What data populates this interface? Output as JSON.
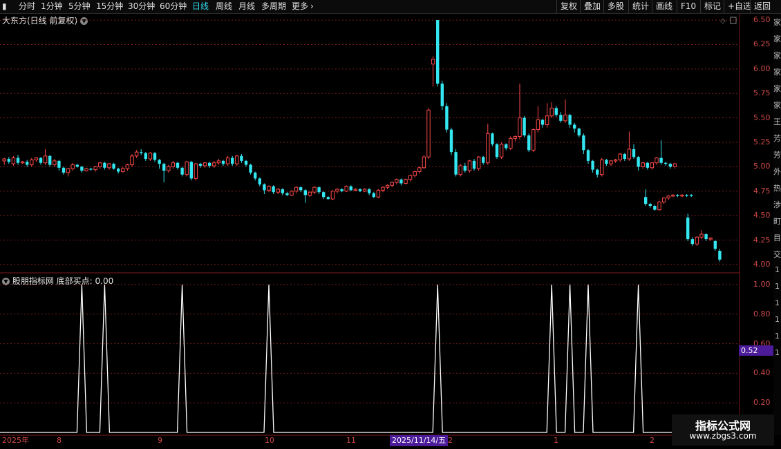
{
  "toolbar": {
    "periods": [
      "分时",
      "1分钟",
      "5分钟",
      "15分钟",
      "30分钟",
      "60分钟",
      "日线",
      "周线",
      "月线",
      "多周期",
      "更多"
    ],
    "active_period": "日线",
    "right_buttons": [
      "复权",
      "叠加",
      "多股",
      "统计",
      "画线",
      "F10",
      "标记",
      "+自选",
      "返回"
    ]
  },
  "stock": {
    "title": "大东方(日线 前复权)"
  },
  "indicator": {
    "title": "股朋指标网 底部买点: 0.00",
    "current_value": "0.52"
  },
  "right_strip_chars": [
    "家",
    "家",
    "家",
    "家",
    "家",
    "家",
    "王",
    "芳",
    "芳",
    "外",
    "热",
    "涉",
    "町",
    "目",
    "交",
    "1",
    "1",
    "1",
    "1",
    "1",
    "1"
  ],
  "date_axis": [
    "2025年",
    "8",
    "9",
    "10",
    "11",
    "2025/11/14/五",
    "2",
    "1",
    "2"
  ],
  "watermark": {
    "line1": "指标公式网",
    "line2": "www.zbgs3.com"
  },
  "colors": {
    "up": "#ff4a4a",
    "down": "#33e6f0",
    "grid": "#7a1d1d",
    "axis": "#d24a4a",
    "highlight": "#4b1b9a"
  },
  "chart_data": [
    {
      "type": "candlestick",
      "title": "大东方(日线 前复权)",
      "ylim": [
        3.95,
        6.55
      ],
      "yticks": [
        "6.50",
        "6.25",
        "6.00",
        "5.75",
        "5.50",
        "5.25",
        "5.00",
        "4.75",
        "4.50",
        "4.25",
        "4.00"
      ],
      "candles": [
        [
          5.06,
          5.08,
          5.02,
          5.09
        ],
        [
          5.08,
          5.05,
          5.03,
          5.1
        ],
        [
          5.03,
          5.09,
          5.01,
          5.11
        ],
        [
          5.09,
          5.04,
          5.02,
          5.12
        ],
        [
          5.04,
          5.05,
          5.03,
          5.06
        ],
        [
          5.05,
          5.02,
          5.0,
          5.07
        ],
        [
          5.02,
          5.07,
          5.0,
          5.09
        ],
        [
          5.07,
          5.09,
          5.05,
          5.1
        ],
        [
          5.09,
          5.04,
          5.02,
          5.1
        ],
        [
          5.04,
          5.11,
          5.02,
          5.18
        ],
        [
          5.11,
          5.02,
          5.0,
          5.12
        ],
        [
          5.02,
          5.06,
          5.0,
          5.08
        ],
        [
          5.06,
          4.99,
          4.96,
          5.07
        ],
        [
          4.99,
          4.94,
          4.92,
          5.0
        ],
        [
          4.94,
          4.98,
          4.9,
          4.99
        ],
        [
          4.98,
          5.02,
          4.96,
          5.04
        ],
        [
          5.02,
          5.0,
          4.99,
          5.03
        ],
        [
          5.0,
          4.96,
          4.94,
          5.01
        ],
        [
          4.96,
          4.98,
          4.95,
          4.99
        ],
        [
          4.98,
          4.97,
          4.96,
          4.99
        ],
        [
          4.97,
          5.0,
          4.95,
          5.01
        ],
        [
          5.0,
          5.04,
          4.98,
          5.05
        ],
        [
          5.04,
          4.99,
          4.97,
          5.05
        ],
        [
          4.99,
          5.03,
          4.97,
          5.04
        ],
        [
          5.03,
          4.98,
          4.97,
          5.04
        ],
        [
          4.98,
          4.95,
          4.93,
          4.99
        ],
        [
          4.95,
          4.98,
          4.94,
          5.0
        ],
        [
          4.98,
          5.02,
          4.96,
          5.03
        ],
        [
          5.02,
          5.11,
          5.0,
          5.13
        ],
        [
          5.11,
          5.15,
          5.09,
          5.17
        ],
        [
          5.15,
          5.14,
          5.12,
          5.18
        ],
        [
          5.14,
          5.08,
          5.06,
          5.15
        ],
        [
          5.08,
          5.14,
          5.06,
          5.15
        ],
        [
          5.14,
          5.07,
          5.05,
          5.15
        ],
        [
          5.07,
          5.03,
          4.98,
          5.08
        ],
        [
          5.03,
          4.96,
          4.84,
          5.04
        ],
        [
          4.96,
          5.0,
          4.94,
          5.02
        ],
        [
          5.0,
          5.04,
          4.98,
          5.06
        ],
        [
          5.04,
          4.99,
          4.97,
          5.05
        ],
        [
          4.99,
          4.92,
          4.9,
          5.0
        ],
        [
          4.92,
          5.05,
          4.9,
          5.06
        ],
        [
          5.05,
          4.88,
          4.86,
          5.06
        ],
        [
          4.88,
          5.03,
          4.86,
          5.04
        ],
        [
          5.03,
          5.01,
          4.99,
          5.04
        ],
        [
          5.01,
          5.04,
          4.99,
          5.05
        ],
        [
          5.04,
          5.01,
          4.99,
          5.05
        ],
        [
          5.01,
          5.04,
          4.99,
          5.06
        ],
        [
          5.04,
          5.06,
          5.02,
          5.08
        ],
        [
          5.06,
          5.03,
          5.01,
          5.07
        ],
        [
          5.03,
          5.09,
          5.01,
          5.11
        ],
        [
          5.09,
          5.03,
          5.01,
          5.11
        ],
        [
          5.03,
          5.11,
          5.01,
          5.12
        ],
        [
          5.11,
          5.06,
          5.04,
          5.13
        ],
        [
          5.06,
          5.02,
          5.0,
          5.07
        ],
        [
          5.02,
          4.94,
          4.92,
          5.03
        ],
        [
          4.94,
          4.88,
          4.86,
          4.95
        ],
        [
          4.88,
          4.82,
          4.8,
          4.89
        ],
        [
          4.82,
          4.76,
          4.72,
          4.83
        ],
        [
          4.76,
          4.8,
          4.74,
          4.81
        ],
        [
          4.8,
          4.74,
          4.72,
          4.81
        ],
        [
          4.74,
          4.77,
          4.72,
          4.78
        ],
        [
          4.77,
          4.73,
          4.71,
          4.78
        ],
        [
          4.73,
          4.71,
          4.7,
          4.74
        ],
        [
          4.71,
          4.75,
          4.7,
          4.76
        ],
        [
          4.75,
          4.79,
          4.73,
          4.8
        ],
        [
          4.79,
          4.76,
          4.74,
          4.8
        ],
        [
          4.76,
          4.71,
          4.63,
          4.77
        ],
        [
          4.71,
          4.74,
          4.69,
          4.75
        ],
        [
          4.74,
          4.79,
          4.72,
          4.8
        ],
        [
          4.79,
          4.74,
          4.72,
          4.8
        ],
        [
          4.74,
          4.69,
          4.67,
          4.75
        ],
        [
          4.69,
          4.67,
          4.66,
          4.7
        ],
        [
          4.67,
          4.75,
          4.66,
          4.76
        ],
        [
          4.75,
          4.77,
          4.73,
          4.78
        ],
        [
          4.77,
          4.75,
          4.74,
          4.78
        ],
        [
          4.75,
          4.8,
          4.74,
          4.81
        ],
        [
          4.8,
          4.76,
          4.75,
          4.81
        ],
        [
          4.76,
          4.77,
          4.75,
          4.78
        ],
        [
          4.77,
          4.75,
          4.74,
          4.78
        ],
        [
          4.75,
          4.77,
          4.74,
          4.78
        ],
        [
          4.77,
          4.73,
          4.71,
          4.78
        ],
        [
          4.73,
          4.69,
          4.68,
          4.74
        ],
        [
          4.69,
          4.76,
          4.68,
          4.77
        ],
        [
          4.76,
          4.79,
          4.74,
          4.8
        ],
        [
          4.79,
          4.81,
          4.77,
          4.82
        ],
        [
          4.81,
          4.84,
          4.79,
          4.85
        ],
        [
          4.84,
          4.87,
          4.82,
          4.88
        ],
        [
          4.87,
          4.83,
          4.81,
          4.88
        ],
        [
          4.83,
          4.87,
          4.82,
          4.88
        ],
        [
          4.87,
          4.91,
          4.85,
          4.92
        ],
        [
          4.91,
          4.95,
          4.89,
          4.96
        ],
        [
          4.95,
          4.99,
          4.93,
          5.0
        ],
        [
          4.99,
          5.1,
          4.98,
          5.12
        ],
        [
          5.1,
          5.58,
          5.08,
          5.6
        ],
        [
          6.05,
          6.1,
          5.82,
          6.13
        ],
        [
          6.5,
          5.85,
          5.82,
          6.5
        ],
        [
          5.85,
          5.62,
          5.58,
          5.88
        ],
        [
          5.62,
          5.38,
          5.35,
          5.65
        ],
        [
          5.38,
          5.15,
          5.12,
          5.4
        ],
        [
          5.15,
          4.92,
          4.9,
          5.18
        ],
        [
          4.92,
          5.01,
          4.9,
          5.03
        ],
        [
          5.01,
          4.96,
          4.94,
          5.04
        ],
        [
          4.96,
          5.06,
          4.94,
          5.07
        ],
        [
          5.06,
          4.98,
          4.96,
          5.08
        ],
        [
          4.98,
          5.1,
          4.96,
          5.11
        ],
        [
          5.1,
          5.04,
          5.02,
          5.11
        ],
        [
          5.04,
          5.34,
          5.02,
          5.44
        ],
        [
          5.34,
          5.23,
          5.21,
          5.35
        ],
        [
          5.23,
          5.1,
          5.08,
          5.24
        ],
        [
          5.1,
          5.23,
          5.08,
          5.25
        ],
        [
          5.23,
          5.19,
          5.17,
          5.24
        ],
        [
          5.19,
          5.29,
          5.17,
          5.31
        ],
        [
          5.29,
          5.31,
          5.26,
          5.32
        ],
        [
          5.31,
          5.5,
          5.28,
          5.85
        ],
        [
          5.5,
          5.32,
          5.3,
          5.52
        ],
        [
          5.32,
          5.17,
          5.15,
          5.34
        ],
        [
          5.17,
          5.38,
          5.15,
          5.39
        ],
        [
          5.38,
          5.48,
          5.35,
          5.62
        ],
        [
          5.48,
          5.43,
          5.4,
          5.49
        ],
        [
          5.43,
          5.52,
          5.4,
          5.65
        ],
        [
          5.52,
          5.6,
          5.5,
          5.66
        ],
        [
          5.6,
          5.53,
          5.51,
          5.62
        ],
        [
          5.53,
          5.47,
          5.45,
          5.56
        ],
        [
          5.47,
          5.53,
          5.45,
          5.69
        ],
        [
          5.53,
          5.43,
          5.4,
          5.54
        ],
        [
          5.43,
          5.39,
          5.35,
          5.45
        ],
        [
          5.39,
          5.32,
          5.3,
          5.4
        ],
        [
          5.32,
          5.17,
          5.13,
          5.34
        ],
        [
          5.17,
          5.06,
          5.03,
          5.18
        ],
        [
          5.06,
          4.97,
          4.94,
          5.07
        ],
        [
          4.97,
          4.92,
          4.89,
          4.98
        ],
        [
          4.92,
          5.07,
          4.9,
          5.09
        ],
        [
          5.07,
          5.03,
          5.01,
          5.08
        ],
        [
          5.03,
          5.06,
          5.01,
          5.07
        ],
        [
          5.06,
          5.07,
          5.04,
          5.08
        ],
        [
          5.07,
          5.13,
          5.05,
          5.14
        ],
        [
          5.13,
          5.08,
          5.06,
          5.14
        ],
        [
          5.08,
          5.18,
          5.06,
          5.36
        ],
        [
          5.18,
          5.1,
          5.08,
          5.23
        ],
        [
          5.1,
          5.0,
          4.96,
          5.11
        ],
        [
          5.0,
          5.04,
          4.98,
          5.05
        ],
        [
          5.04,
          4.99,
          4.97,
          5.05
        ],
        [
          4.99,
          5.04,
          4.97,
          5.05
        ],
        [
          5.04,
          5.09,
          5.02,
          5.1
        ],
        [
          5.09,
          5.04,
          5.02,
          5.27
        ],
        [
          5.04,
          5.03,
          5.01,
          5.05
        ],
        [
          5.03,
          5.0,
          4.98,
          5.04
        ],
        [
          5.0,
          5.03,
          4.98,
          5.04
        ]
      ],
      "gap_candles": [
        [
          4.69,
          4.62,
          4.6,
          4.77
        ],
        [
          4.62,
          4.6,
          4.58,
          4.63
        ],
        [
          4.6,
          4.56,
          4.55,
          4.61
        ],
        [
          4.56,
          4.64,
          4.55,
          4.65
        ],
        [
          4.64,
          4.68,
          4.62,
          4.69
        ],
        [
          4.68,
          4.7,
          4.66,
          4.71
        ],
        [
          4.7,
          4.71,
          4.69,
          4.72
        ],
        [
          4.71,
          4.7,
          4.69,
          4.72
        ],
        [
          4.7,
          4.71,
          4.69,
          4.72
        ],
        [
          4.71,
          4.7,
          4.69,
          4.72
        ],
        [
          4.71,
          4.7,
          4.69,
          4.72
        ],
        [
          4.48,
          4.26,
          4.24,
          4.52
        ],
        [
          4.26,
          4.21,
          4.19,
          4.28
        ],
        [
          4.21,
          4.28,
          4.19,
          4.29
        ],
        [
          4.28,
          4.31,
          4.26,
          4.35
        ],
        [
          4.31,
          4.26,
          4.24,
          4.32
        ],
        [
          4.26,
          4.27,
          4.24,
          4.28
        ],
        [
          4.24,
          4.16,
          4.14,
          4.25
        ],
        [
          4.14,
          4.05,
          4.03,
          4.16
        ]
      ]
    },
    {
      "type": "line",
      "title": "股朋指标网 底部买点",
      "series": [
        {
          "name": "底部买点",
          "spikes_at_index": [
            17,
            22,
            39,
            58,
            95,
            120,
            124,
            128,
            139
          ]
        }
      ],
      "baseline": 0.0,
      "peak": 1.0,
      "ylim": [
        0,
        1.07
      ],
      "yticks": [
        "1.00",
        "0.80",
        "0.60",
        "0.40",
        "0.20"
      ],
      "current": 0.52
    }
  ]
}
